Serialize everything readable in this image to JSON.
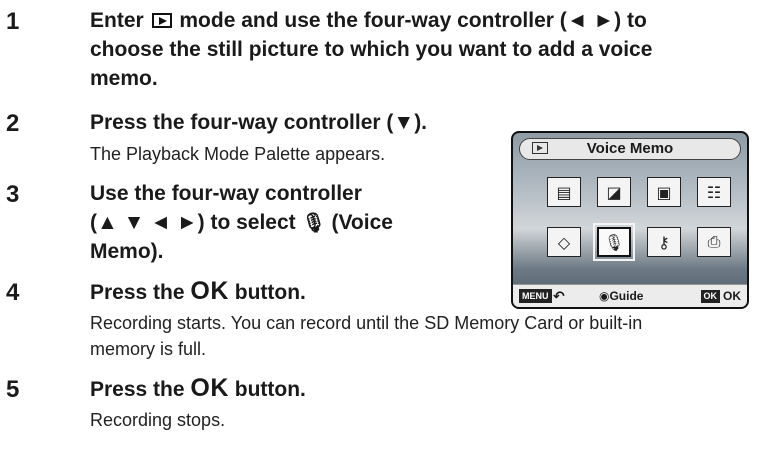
{
  "steps": [
    {
      "number": "1",
      "line1_before": "Enter",
      "line1_after": "mode and use the four-way controller (◄ ►) to",
      "line2": "choose the still picture to which you want to add a voice",
      "line3": "memo."
    },
    {
      "number": "2",
      "heading": "Press the four-way controller (▼).",
      "desc": "The Playback Mode Palette appears."
    },
    {
      "number": "3",
      "line1": "Use the four-way controller",
      "line2_before": "(▲ ▼ ◄ ►) to select",
      "line2_after": "(Voice",
      "line3": "Memo)."
    },
    {
      "number": "4",
      "before": "Press the",
      "ok": "OK",
      "after": "button.",
      "desc1": "Recording starts. You can record until the SD Memory Card or built-in",
      "desc2": "memory is full."
    },
    {
      "number": "5",
      "before": "Press the",
      "ok": "OK",
      "after": "button.",
      "desc": "Recording stops."
    }
  ],
  "screen": {
    "title": "Voice Memo",
    "icons": [
      {
        "name": "slideshow-icon",
        "glyph": "▤"
      },
      {
        "name": "resize-icon",
        "glyph": "◪"
      },
      {
        "name": "frame-icon",
        "glyph": "▣"
      },
      {
        "name": "image-recovery-icon",
        "glyph": "☷"
      },
      {
        "name": "rotate-icon",
        "glyph": "◇"
      },
      {
        "name": "voice-memo-icon",
        "glyph": "🎙"
      },
      {
        "name": "protect-icon",
        "glyph": "⚷"
      },
      {
        "name": "dpof-icon",
        "glyph": "⎙"
      }
    ],
    "footer": {
      "menu": "MENU",
      "back": "↶",
      "guide": "◉Guide",
      "ok_box": "OK",
      "ok": "OK"
    }
  }
}
